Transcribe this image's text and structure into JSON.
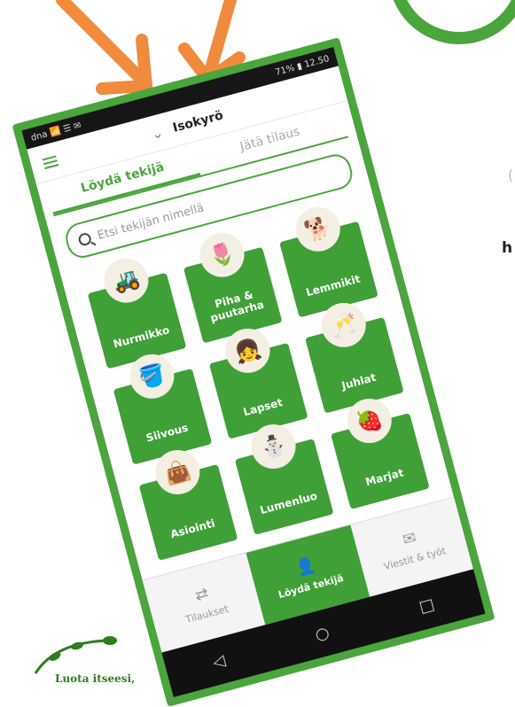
{
  "status": {
    "left": "dna 📶 ☰ ✉",
    "right": "71% ▮ 12.50"
  },
  "header": {
    "location": "Isokyrö"
  },
  "tabs": [
    {
      "label": "Löydä tekijä"
    },
    {
      "label": "Jätä tilaus"
    }
  ],
  "search": {
    "placeholder": "Etsi tekijän nimellä"
  },
  "categories": [
    {
      "label": "Nurmikko",
      "icon": "lawnmower-icon"
    },
    {
      "label": "Piha & puutarha",
      "icon": "wheelbarrow-icon"
    },
    {
      "label": "Lemmikit",
      "icon": "dog-icon"
    },
    {
      "label": "Siivous",
      "icon": "bucket-icon"
    },
    {
      "label": "Lapset",
      "icon": "child-icon"
    },
    {
      "label": "Juhlat",
      "icon": "drink-icon"
    },
    {
      "label": "Asiointi",
      "icon": "bag-icon"
    },
    {
      "label": "Lumenluo",
      "icon": "shovel-icon"
    },
    {
      "label": "Marjat",
      "icon": "berries-icon"
    }
  ],
  "bottom_nav": [
    {
      "label": "Tilaukset",
      "icon": "swap-icon"
    },
    {
      "label": "Löydä tekijä",
      "icon": "person-icon"
    },
    {
      "label": "Viestit & työt",
      "icon": "mail-icon"
    }
  ],
  "slogan": {
    "text": "Luota itseesi,"
  },
  "colors": {
    "brand_green": "#3fa037",
    "arrow_orange": "#f08a3c"
  }
}
